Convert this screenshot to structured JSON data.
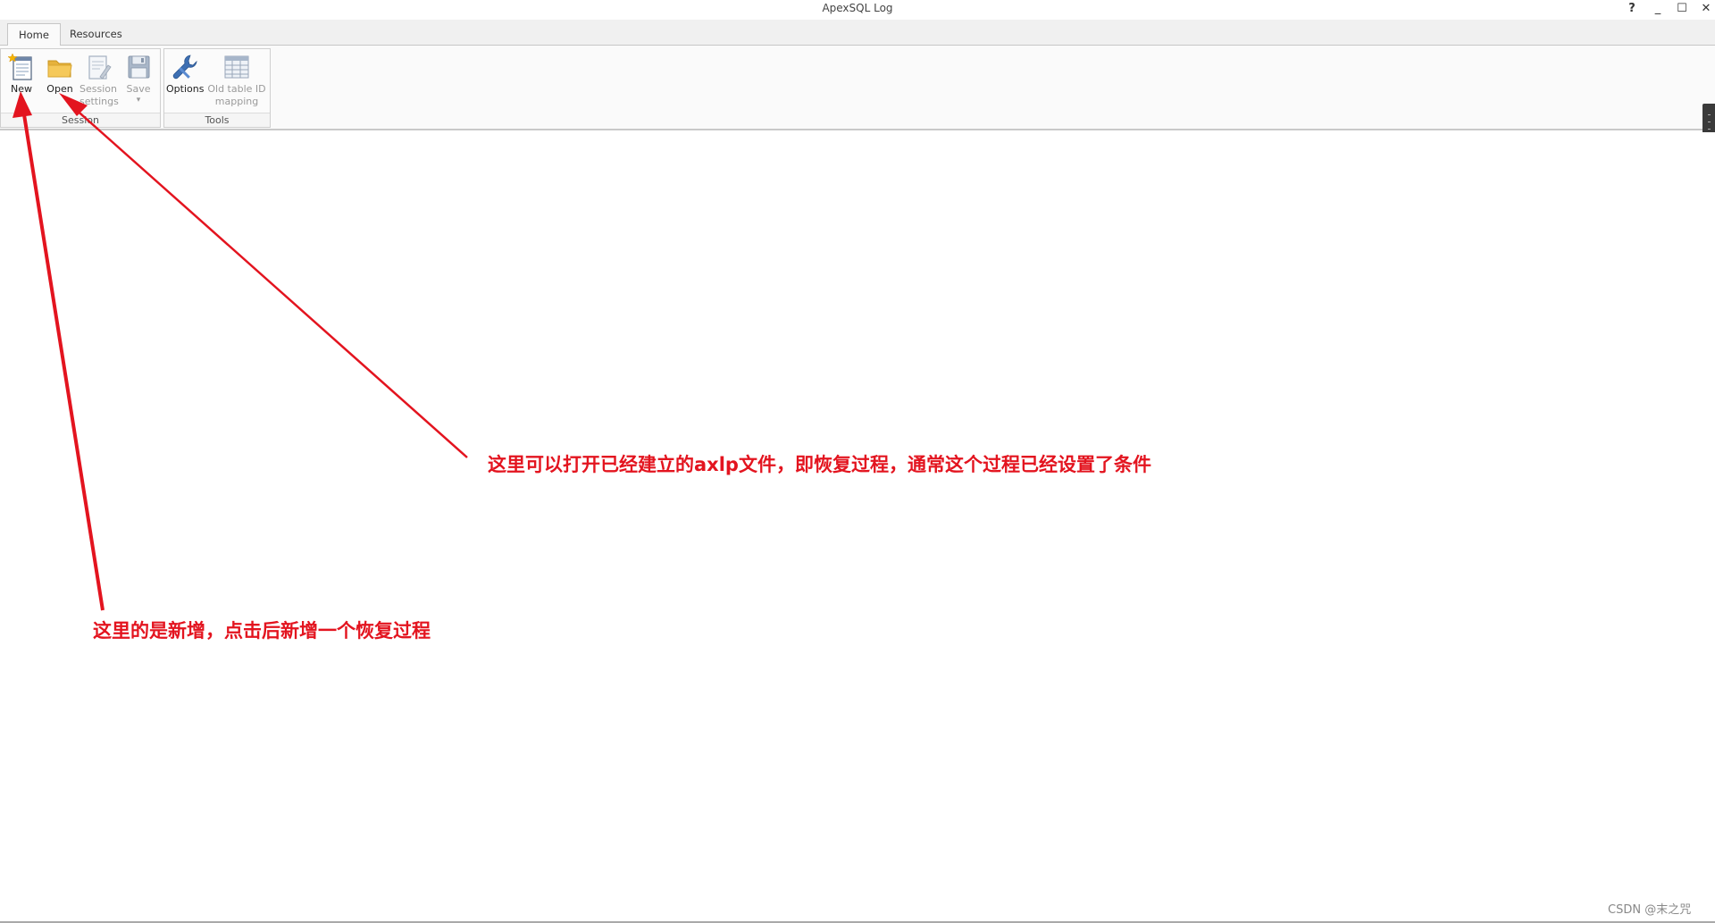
{
  "window": {
    "title": "ApexSQL Log",
    "controls": {
      "help": "?",
      "minimize": "_",
      "maximize": "☐",
      "close": "✕"
    }
  },
  "tabs": [
    {
      "label": "Home",
      "active": true
    },
    {
      "label": "Resources",
      "active": false
    }
  ],
  "ribbon": {
    "session_group": {
      "label": "Session",
      "buttons": {
        "new": {
          "label": "New",
          "icon": "new-document-icon",
          "enabled": true
        },
        "open": {
          "label": "Open",
          "icon": "folder-icon",
          "enabled": true
        },
        "session_settings": {
          "label_line1": "Session",
          "label_line2": "settings",
          "icon": "session-settings-icon",
          "enabled": false
        },
        "save": {
          "label": "Save",
          "dropdown": "▾",
          "icon": "floppy-disk-icon",
          "enabled": false
        }
      }
    },
    "tools_group": {
      "label": "Tools",
      "buttons": {
        "options": {
          "label": "Options",
          "icon": "wrench-icon",
          "enabled": true
        },
        "old_table_id_mapping": {
          "label_line1": "Old table ID",
          "label_line2": "mapping",
          "icon": "table-grid-icon",
          "enabled": false
        }
      }
    }
  },
  "annotations": {
    "open_note": "这里可以打开已经建立的axlp文件，即恢复过程，通常这个过程已经设置了条件",
    "new_note": "这里的是新增，点击后新增一个恢复过程",
    "color": "#e3141f"
  },
  "watermark": "CSDN @末之咒"
}
